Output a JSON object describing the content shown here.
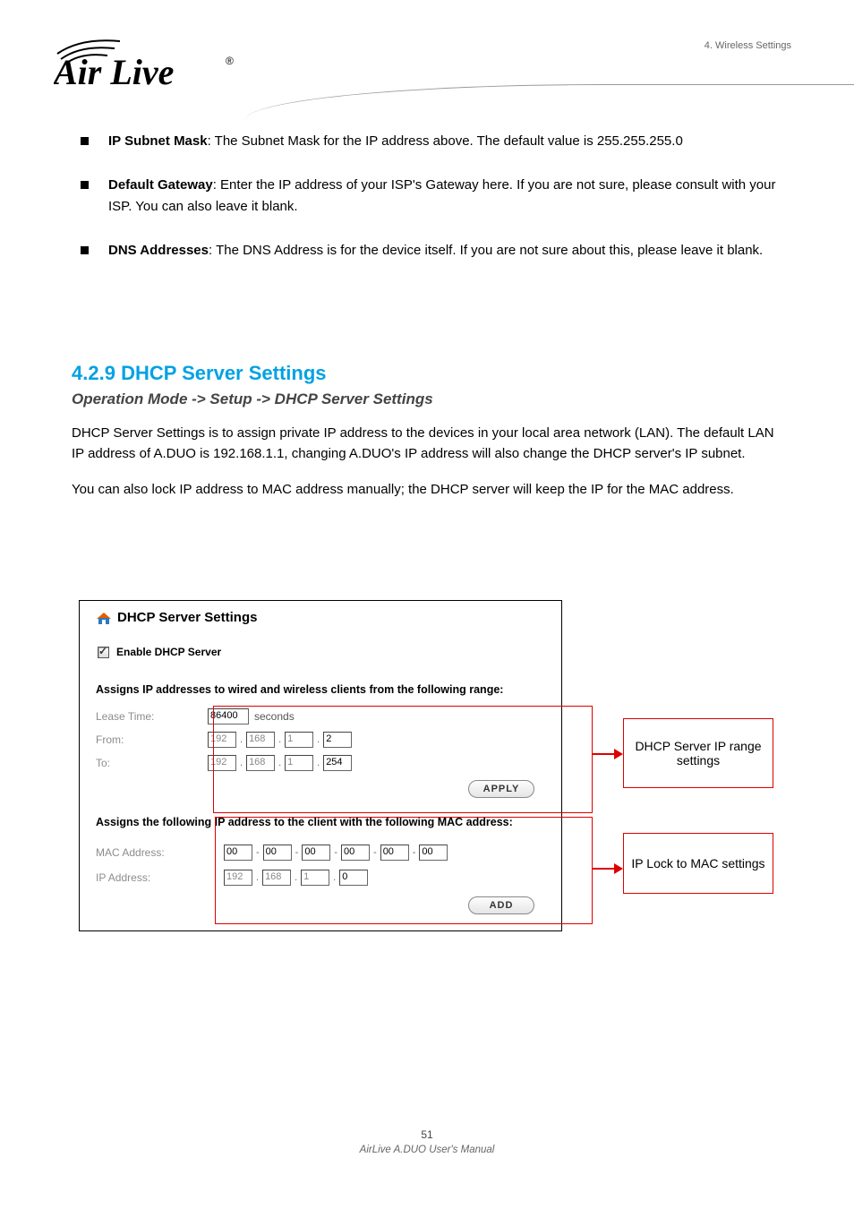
{
  "chapterTitle": "4. Wireless Settings",
  "bullets": [
    {
      "label": "IP Subnet Mask",
      "text": ": The Subnet Mask for the IP address above. The default value is 255.255.255.0"
    },
    {
      "label": "Default Gateway",
      "text": ": Enter the IP address of your ISP's Gateway here. If you are not sure, please consult with your ISP. You can also leave it blank."
    },
    {
      "label": "DNS Addresses",
      "text": ": The DNS Address is for the device itself. If you are not sure about this, please leave it blank."
    }
  ],
  "section": {
    "number": "4.2.9",
    "title": "DHCP Server Settings",
    "path": "Operation Mode -> Setup -> DHCP Server Settings",
    "body": [
      "DHCP Server Settings is to assign private IP address to the devices in your local area network (LAN). The default LAN IP address of A.DUO is 192.168.1.1, changing A.DUO's IP address will also change the DHCP server's IP subnet.",
      "You can also lock IP address to MAC address manually; the DHCP server will keep the IP for the MAC address."
    ]
  },
  "panel": {
    "title": "DHCP Server Settings",
    "enable": "Enable DHCP Server",
    "assigns1": "Assigns IP addresses to wired and wireless clients from the following range:",
    "leaseLabel": "Lease Time:",
    "leaseValue": "86400",
    "seconds": "seconds",
    "fromLabel": "From:",
    "from": [
      "192",
      "168",
      "1",
      "2"
    ],
    "toLabel": "To:",
    "to": [
      "192",
      "168",
      "1",
      "254"
    ],
    "applyBtn": "APPLY",
    "assigns2": "Assigns the following IP address to the client with the following MAC address:",
    "macLabel": "MAC Address:",
    "mac": [
      "00",
      "00",
      "00",
      "00",
      "00",
      "00"
    ],
    "ipLabel": "IP Address:",
    "ip": [
      "192",
      "168",
      "1",
      "0"
    ],
    "addBtn": "ADD"
  },
  "callouts": {
    "a": "DHCP Server IP range settings",
    "b": "IP Lock to MAC settings"
  },
  "footer": {
    "page": "51",
    "line1": "AirLive A.DUO User's Manual"
  }
}
